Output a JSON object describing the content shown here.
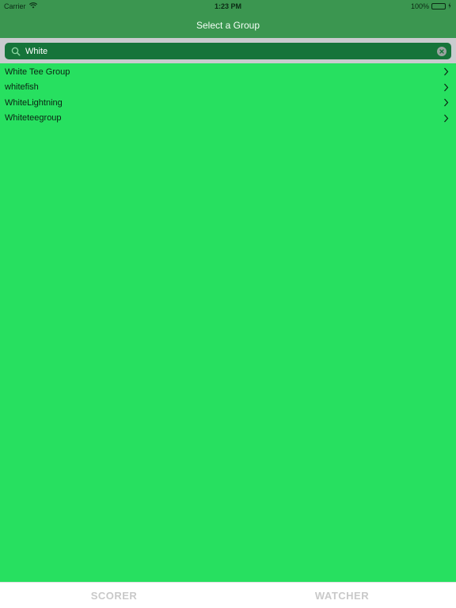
{
  "status_bar": {
    "carrier": "Carrier",
    "time": "1:23 PM",
    "battery_percent": "100%",
    "icons": [
      "wifi-icon",
      "battery-icon"
    ]
  },
  "nav": {
    "title": "Select a Group"
  },
  "search": {
    "value": "White",
    "icons": [
      "search-icon",
      "clear-icon"
    ]
  },
  "results": [
    {
      "label": "White Tee Group"
    },
    {
      "label": "whitefish"
    },
    {
      "label": "WhiteLightning"
    },
    {
      "label": "Whiteteegroup"
    }
  ],
  "tabs": [
    {
      "label": "SCORER"
    },
    {
      "label": "WATCHER"
    }
  ],
  "colors": {
    "nav_background": "#3b9650",
    "content_background": "#27e060",
    "search_field": "#16743a",
    "tab_inactive_text": "#c9c9c9"
  }
}
